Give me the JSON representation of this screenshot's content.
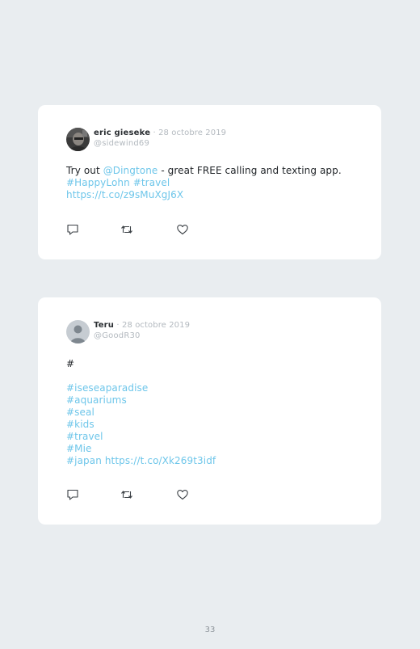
{
  "tweets": [
    {
      "author": "eric gieseke",
      "separator": " · ",
      "date": "28 octobre 2019",
      "handle": "@sidewind69",
      "lines": [
        [
          "Try out ",
          "@Dingtone",
          " - great FREE calling and texting app."
        ],
        [
          "#HappyLohn",
          " ",
          "#travel"
        ],
        [
          "https://t.co/z9sMuXgJ6X"
        ]
      ],
      "actions": [
        "reply-icon",
        "retweet-icon",
        "like-icon"
      ]
    },
    {
      "author": "Teru",
      "separator": " · ",
      "date": "28 octobre 2019",
      "handle": "@GoodR30",
      "lines": [
        [
          "#"
        ],
        [
          ""
        ],
        [
          "#iseseaparadise"
        ],
        [
          "#aquariums"
        ],
        [
          "#seal"
        ],
        [
          "#kids"
        ],
        [
          "#travel"
        ],
        [
          "#Mie"
        ],
        [
          "#japan",
          " ",
          "https://t.co/Xk269t3idf"
        ]
      ],
      "actions": [
        "reply-icon",
        "retweet-icon",
        "like-icon"
      ]
    }
  ],
  "page_number": "33",
  "colors": {
    "background": "#e9edf0",
    "card": "#ffffff",
    "link": "#6ec6ea",
    "muted": "#b3b9bf",
    "text": "#1f2327"
  }
}
